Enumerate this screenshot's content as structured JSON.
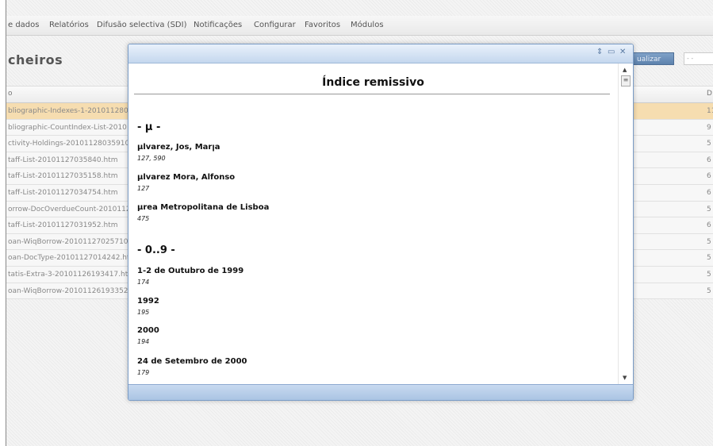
{
  "menu": {
    "items": [
      "e dados",
      "Relatórios",
      "Difusão selectiva (SDI)",
      "Notificações",
      "Configurar",
      "Favoritos",
      "Módulos"
    ]
  },
  "page": {
    "title": "cheiros",
    "refresh_button_label": "ualizar",
    "mini_input_value": "- -"
  },
  "table": {
    "col_a": "o",
    "col_b": "D",
    "rows": [
      {
        "name": "bliographic-Indexes-1-201011280",
        "num": "11",
        "selected": true
      },
      {
        "name": "bliographic-CountIndex-List-2010",
        "num": "9"
      },
      {
        "name": "ctivity-Holdings-20101128035910.",
        "num": "5"
      },
      {
        "name": "taff-List-20101127035840.htm",
        "num": "6"
      },
      {
        "name": "taff-List-20101127035158.htm",
        "num": "6"
      },
      {
        "name": "taff-List-20101127034754.htm",
        "num": "6"
      },
      {
        "name": "orrow-DocOverdueCount-2010112",
        "num": "5"
      },
      {
        "name": "taff-List-20101127031952.htm",
        "num": "6"
      },
      {
        "name": "oan-WiqBorrow-20101127025710.",
        "num": "5"
      },
      {
        "name": "oan-DocType-20101127014242.ht",
        "num": "5"
      },
      {
        "name": "tatis-Extra-3-20101126193417.ht",
        "num": "5"
      },
      {
        "name": "oan-WiqBorrow-20101126193352.",
        "num": "5"
      }
    ]
  },
  "dialog": {
    "controls": {
      "pin": "⇕",
      "minimize": "▭",
      "close": "✕"
    },
    "heading": "Índice remissivo",
    "sections": [
      {
        "header": "- µ -",
        "entries": [
          {
            "term": "µlvarez, Jos, Marןa",
            "pages": "127, 590"
          },
          {
            "term": "µlvarez Mora, Alfonso",
            "pages": "127"
          },
          {
            "term": "µrea Metropolitana de Lisboa",
            "pages": "475"
          }
        ]
      },
      {
        "header": "- 0..9 -",
        "entries": [
          {
            "term": "1-2 de Outubro de 1999",
            "pages": "174"
          },
          {
            "term": "1992",
            "pages": "195"
          },
          {
            "term": "2000",
            "pages": "194"
          },
          {
            "term": "24 de Setembro de 2000",
            "pages": "179"
          }
        ]
      }
    ]
  }
}
